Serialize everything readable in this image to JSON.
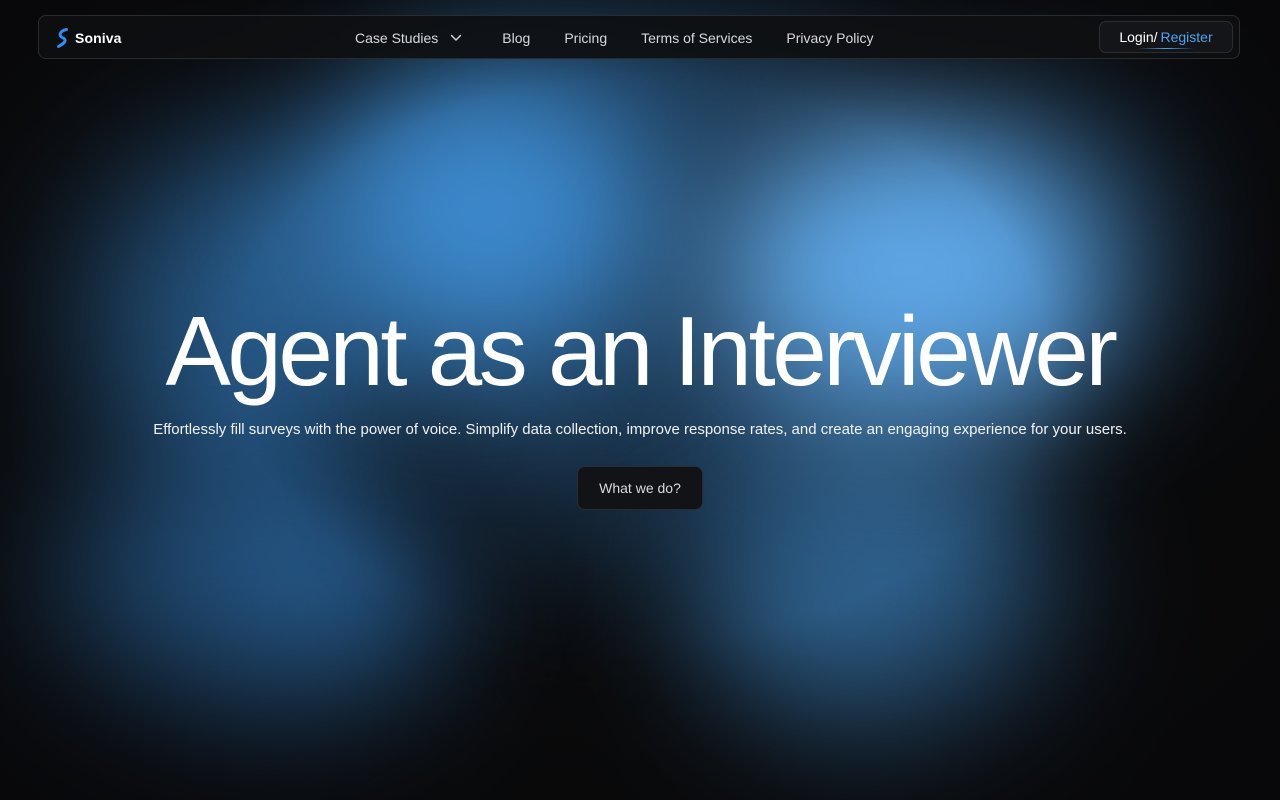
{
  "brand": {
    "name": "Soniva",
    "logo_icon": "soniva-logo-icon",
    "accent_color": "#4da3f0"
  },
  "nav": {
    "items": [
      {
        "label": "Case Studies",
        "has_dropdown": true,
        "icon": "chevron-down-icon"
      },
      {
        "label": "Blog"
      },
      {
        "label": "Pricing"
      },
      {
        "label": "Terms of Services"
      },
      {
        "label": "Privacy Policy"
      }
    ],
    "auth": {
      "login_label": "Login/",
      "register_label": "Register"
    }
  },
  "hero": {
    "title": "Agent as an Interviewer",
    "subtitle": "Effortlessly fill surveys with the power of voice. Simplify data collection, improve response rates, and create an engaging experience for your users.",
    "cta_label": "What we do?"
  }
}
